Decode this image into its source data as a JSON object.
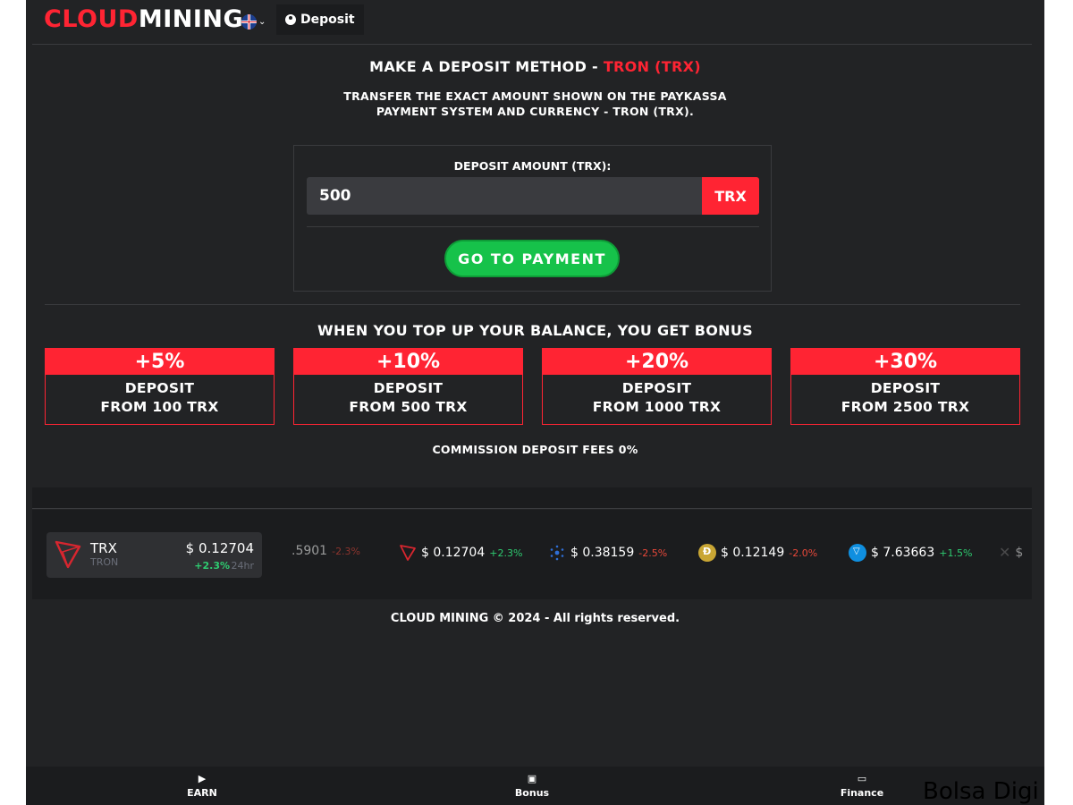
{
  "header": {
    "logo_red": "CLOUD",
    "logo_white": "MINING",
    "language_flag": "uk-flag",
    "deposit_tab": "Deposit"
  },
  "deposit": {
    "title_prefix": "MAKE A DEPOSIT METHOD - ",
    "title_method": "TRON (TRX)",
    "instructions_line1": "TRANSFER THE EXACT AMOUNT SHOWN ON THE PAYKASSA",
    "instructions_line2": "PAYMENT SYSTEM AND CURRENCY - TRON (TRX).",
    "amount_label": "DEPOSIT AMOUNT (TRX):",
    "amount_value": "500",
    "amount_unit": "TRX",
    "pay_button": "GO TO PAYMENT"
  },
  "bonus": {
    "title": "WHEN YOU TOP UP YOUR BALANCE, YOU GET BONUS",
    "tiers": [
      {
        "percent": "+5%",
        "line1": "DEPOSIT",
        "line2": "FROM 100 TRX"
      },
      {
        "percent": "+10%",
        "line1": "DEPOSIT",
        "line2": "FROM 500 TRX"
      },
      {
        "percent": "+20%",
        "line1": "DEPOSIT",
        "line2": "FROM 1000 TRX"
      },
      {
        "percent": "+30%",
        "line1": "DEPOSIT",
        "line2": "FROM 2500 TRX"
      }
    ],
    "commission": "COMMISSION DEPOSIT FEES 0%"
  },
  "ticker": {
    "main": {
      "symbol": "TRX",
      "name": "TRON",
      "price": "$ 0.12704",
      "change": "+2.3%",
      "period": "24hr"
    },
    "items": [
      {
        "icon": "partial-coin",
        "price": ".5901",
        "change": "-2.3%",
        "dir": "down"
      },
      {
        "icon": "tron-icon",
        "price": "$ 0.12704",
        "change": "+2.3%",
        "dir": "up"
      },
      {
        "icon": "cardano-icon",
        "price": "$ 0.38159",
        "change": "-2.5%",
        "dir": "down"
      },
      {
        "icon": "dogecoin-icon",
        "price": "$ 0.12149",
        "change": "-2.0%",
        "dir": "down"
      },
      {
        "icon": "toncoin-icon",
        "price": "$ 7.63663",
        "change": "+1.5%",
        "dir": "up"
      },
      {
        "icon": "xrp-icon",
        "price": "$",
        "change": "",
        "dir": "up"
      }
    ]
  },
  "footer": {
    "text": "CLOUD MINING © 2024 - All rights reserved."
  },
  "nav": {
    "earn": "EARN",
    "bonus": "Bonus",
    "finance": "Finance"
  },
  "watermark": "Bolsa Digi",
  "colors": {
    "accent": "#ff2433",
    "success": "#16c24a",
    "background": "#222325"
  }
}
